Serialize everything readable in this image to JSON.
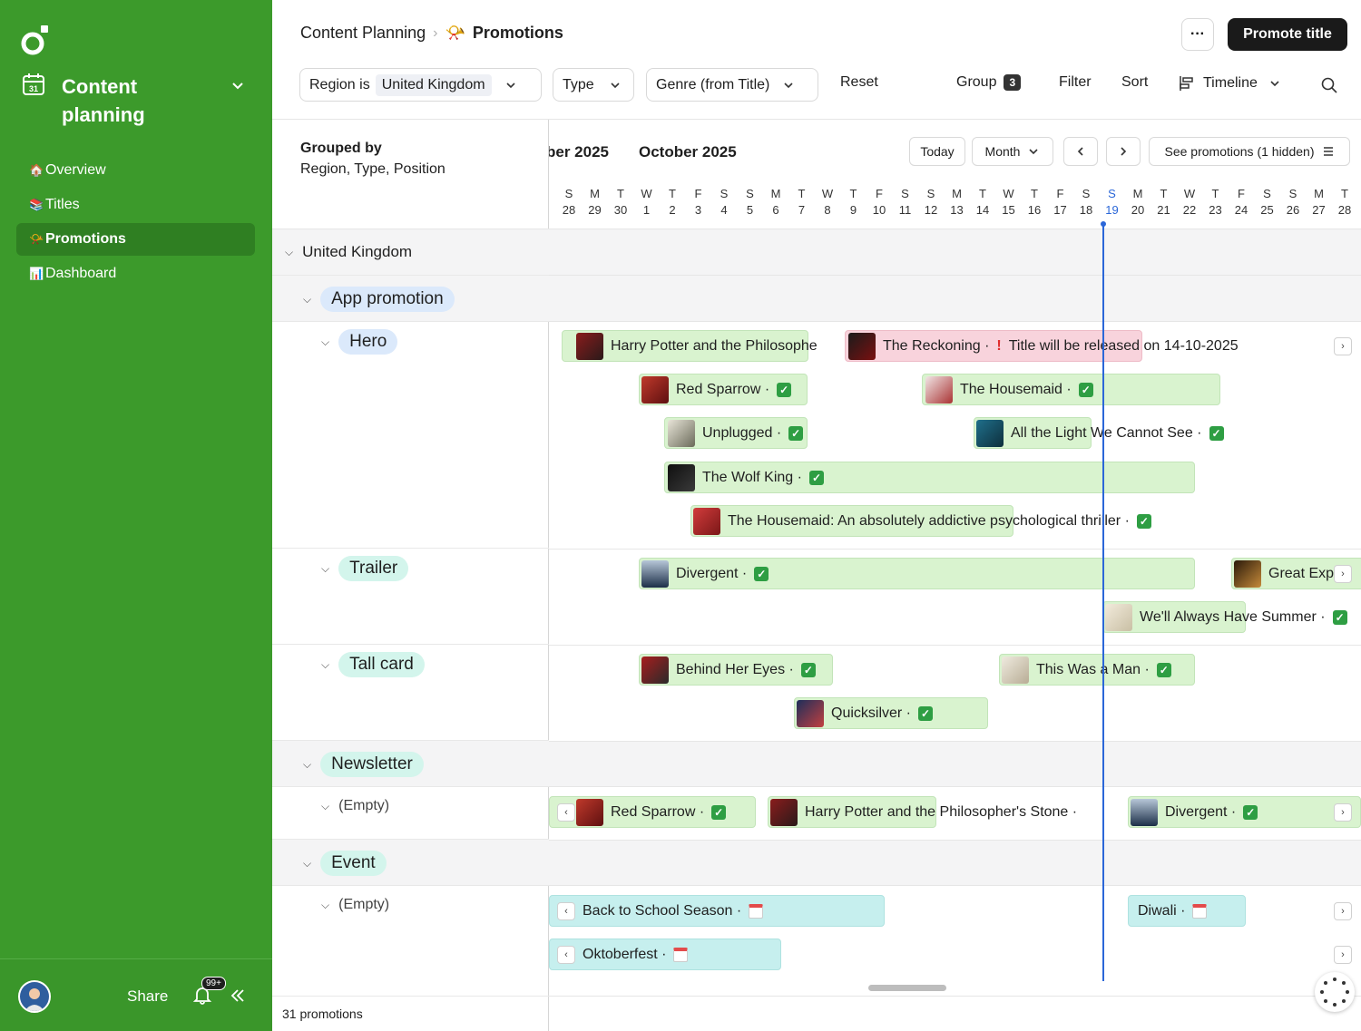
{
  "sidebar": {
    "workspace_title": "Content planning",
    "nav": [
      {
        "label": "Overview",
        "emoji": "🏠"
      },
      {
        "label": "Titles",
        "emoji": "📚"
      },
      {
        "label": "Promotions",
        "emoji": "📯"
      },
      {
        "label": "Dashboard",
        "emoji": "📊"
      }
    ],
    "active_nav": "Promotions",
    "footer": {
      "share_label": "Share",
      "notification_badge": "99+"
    }
  },
  "header": {
    "breadcrumb_root": "Content Planning",
    "breadcrumb_current": "Promotions",
    "breadcrumb_emoji": "📯",
    "more_label": "···",
    "primary_button": "Promote title"
  },
  "filters": {
    "region_prefix": "Region is",
    "region_value": "United Kingdom",
    "type_label": "Type",
    "genre_label": "Genre (from Title)",
    "reset_label": "Reset",
    "group_label": "Group",
    "group_count": "3",
    "filter_label": "Filter",
    "sort_label": "Sort",
    "view_label": "Timeline"
  },
  "grouping": {
    "title": "Grouped by",
    "fields": "Region, Type, Position",
    "region": "United Kingdom",
    "types": [
      {
        "name": "App promotion",
        "positions": [
          "Hero",
          "Trailer",
          "Tall card"
        ]
      },
      {
        "name": "Newsletter",
        "positions": [
          "(Empty)"
        ]
      },
      {
        "name": "Event",
        "positions": [
          "(Empty)"
        ]
      }
    ],
    "footer_count": "31 promotions"
  },
  "timeline": {
    "month_prev": "ber 2025",
    "month_current": "October 2025",
    "today_label": "Today",
    "scale_label": "Month",
    "see_promotions_label": "See promotions (1 hidden)",
    "today_day": "19",
    "day_letters": [
      "S",
      "M",
      "T",
      "W",
      "T",
      "F",
      "S",
      "S",
      "M",
      "T",
      "W",
      "T",
      "F",
      "S",
      "S",
      "M",
      "T",
      "W",
      "T",
      "F",
      "S",
      "S",
      "M",
      "T",
      "W",
      "T",
      "F",
      "S",
      "S",
      "M",
      "T"
    ],
    "day_numbers": [
      "28",
      "29",
      "30",
      "1",
      "2",
      "3",
      "4",
      "5",
      "6",
      "7",
      "8",
      "9",
      "10",
      "11",
      "12",
      "13",
      "14",
      "15",
      "16",
      "17",
      "18",
      "19",
      "20",
      "21",
      "22",
      "23",
      "24",
      "25",
      "26",
      "27",
      "28"
    ]
  },
  "promotions": {
    "hero": [
      {
        "title": "Harry Potter and the Philosophe",
        "suffix": ""
      },
      {
        "title": "The Reckoning ·",
        "warning": "Title will be released on 14-10-2025"
      },
      {
        "title": "Red Sparrow ·"
      },
      {
        "title": "The Housemaid ·"
      },
      {
        "title": "Unplugged ·"
      },
      {
        "title": "All the Light We Cannot See ·"
      },
      {
        "title": "The Wolf King ·"
      },
      {
        "title": "The Housemaid: An absolutely addictive psychological thriller ·"
      }
    ],
    "trailer": [
      {
        "title": "Divergent ·"
      },
      {
        "title": "Great Exp"
      },
      {
        "title": "We'll Always Have Summer ·"
      }
    ],
    "tall_card": [
      {
        "title": "Behind Her Eyes ·"
      },
      {
        "title": "This Was a Man ·"
      },
      {
        "title": "Quicksilver ·"
      }
    ],
    "newsletter": [
      {
        "title": "Red Sparrow ·"
      },
      {
        "title": "Harry Potter and the Philosopher's Stone ·"
      },
      {
        "title": "Divergent ·"
      }
    ],
    "event": [
      {
        "title": "Back to School Season ·"
      },
      {
        "title": "Diwali ·"
      },
      {
        "title": "Oktoberfest ·"
      }
    ]
  },
  "colors": {
    "sidebar_bg": "#3c9a2b",
    "sidebar_active": "#2f7f22",
    "today_line": "#2b67d8",
    "bar_green": "#d9f3cf",
    "bar_pink": "#f8d3dc",
    "bar_teal": "#c6efee",
    "check_green": "#2e9e43"
  },
  "icons": {
    "logo": "ring-dot-logo-icon",
    "calendar": "calendar-icon",
    "bell": "bell-icon",
    "collapse": "double-chevron-left-icon",
    "search": "search-icon",
    "timeline": "timeline-icon",
    "check": "check-box-icon",
    "event_calendar": "calendar-emoji-icon"
  }
}
